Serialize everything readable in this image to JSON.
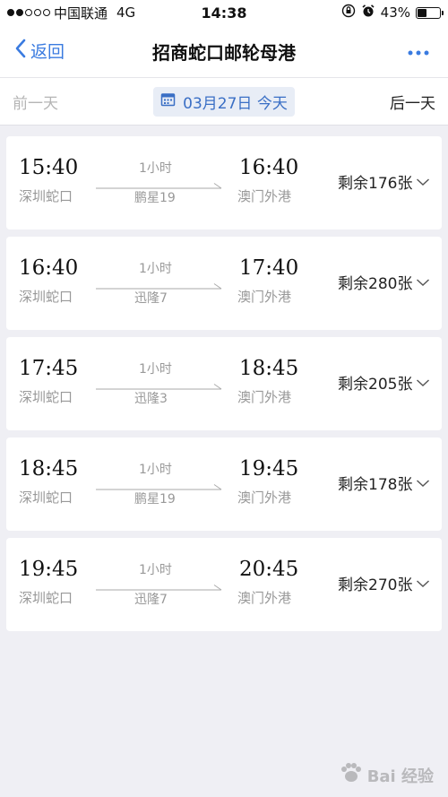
{
  "status_bar": {
    "carrier": "中国联通",
    "network": "4G",
    "time": "14:38",
    "battery": "43%",
    "battery_level": 0.43
  },
  "nav": {
    "back_label": "返回",
    "title": "招商蛇口邮轮母港"
  },
  "date_bar": {
    "prev_label": "前一天",
    "date_label": "03月27日 今天",
    "next_label": "后一天"
  },
  "trips": [
    {
      "dep_time": "15:40",
      "dep_port": "深圳蛇口",
      "duration": "1小时",
      "ship": "鹏星19",
      "arr_time": "16:40",
      "arr_port": "澳门外港",
      "remaining": "剩余176张"
    },
    {
      "dep_time": "16:40",
      "dep_port": "深圳蛇口",
      "duration": "1小时",
      "ship": "迅隆7",
      "arr_time": "17:40",
      "arr_port": "澳门外港",
      "remaining": "剩余280张"
    },
    {
      "dep_time": "17:45",
      "dep_port": "深圳蛇口",
      "duration": "1小时",
      "ship": "迅隆3",
      "arr_time": "18:45",
      "arr_port": "澳门外港",
      "remaining": "剩余205张"
    },
    {
      "dep_time": "18:45",
      "dep_port": "深圳蛇口",
      "duration": "1小时",
      "ship": "鹏星19",
      "arr_time": "19:45",
      "arr_port": "澳门外港",
      "remaining": "剩余178张"
    },
    {
      "dep_time": "19:45",
      "dep_port": "深圳蛇口",
      "duration": "1小时",
      "ship": "迅隆7",
      "arr_time": "20:45",
      "arr_port": "澳门外港",
      "remaining": "剩余270张"
    }
  ],
  "watermark": {
    "text": "Bai 经验"
  },
  "colors": {
    "accent": "#3a7be0",
    "date_pill_bg": "#e8edf6",
    "background": "#efeff4"
  }
}
